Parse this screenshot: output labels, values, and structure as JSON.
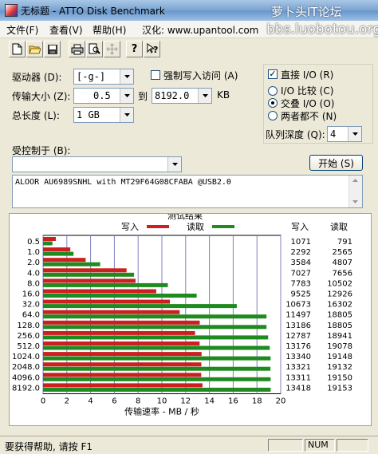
{
  "window": {
    "title": "无标题 - ATTO Disk Benchmark"
  },
  "watermark": {
    "line1": "萝卜头IT论坛",
    "line2": "bbs.luobotou.org"
  },
  "menu": [
    "文件(F)",
    "查看(V)",
    "帮助(H)",
    "汉化: www.upantool.com"
  ],
  "toolbar": {
    "icons": [
      "new-file-icon",
      "open-folder-icon",
      "save-icon",
      "print-icon",
      "print-preview-icon",
      "move-icon",
      "help-icon",
      "context-help-icon"
    ]
  },
  "form": {
    "drive_label": "驱动器 (D):",
    "drive_value": "[-g-]",
    "force_write_label": "强制写入访问 (A)",
    "transfer_label": "传输大小 (Z):",
    "transfer_from": "0.5",
    "to_label": "到",
    "transfer_to": "8192.0",
    "kb_label": "KB",
    "length_label": "总长度 (L):",
    "length_value": "1 GB",
    "direct_io_label": "直接 I/O (R)",
    "direct_io_checked": true,
    "radio_compare": "I/O 比较 (C)",
    "radio_overlap": "交叠 I/O (O)",
    "radio_neither": "两者都不 (N)",
    "selected_radio": "radio_overlap",
    "queue_label": "队列深度 (Q):",
    "queue_value": "4",
    "controlled_label": "受控制于 (B):",
    "controlled_value": "",
    "start_label": "开始 (S)",
    "description": "ALOOR AU6989SNHL with MT29F64G08CFABA @USB2.0"
  },
  "results": {
    "group_label": "测试结果",
    "legend_write": "写入",
    "legend_read": "读取",
    "col_write": "写入",
    "col_read": "读取",
    "xlabel": "传输速率 - MB / 秒"
  },
  "colors": {
    "write": "#cc1f1f",
    "read": "#1f8a1f"
  },
  "chart_data": {
    "type": "bar",
    "orientation": "horizontal",
    "title": "测试结果",
    "xlabel": "传输速率 - MB / 秒",
    "xlim": [
      0,
      20
    ],
    "xticks": [
      0,
      2,
      4,
      6,
      8,
      10,
      12,
      14,
      16,
      18,
      20
    ],
    "grid": true,
    "legend": "top",
    "categories": [
      "0.5",
      "1.0",
      "2.0",
      "4.0",
      "8.0",
      "16.0",
      "32.0",
      "64.0",
      "128.0",
      "256.0",
      "512.0",
      "1024.0",
      "2048.0",
      "4096.0",
      "8192.0"
    ],
    "series": [
      {
        "name": "写入",
        "values": [
          1.071,
          2.292,
          3.584,
          7.027,
          7.783,
          9.525,
          10.673,
          11.497,
          13.186,
          12.787,
          13.176,
          13.34,
          13.321,
          13.311,
          13.418
        ]
      },
      {
        "name": "读取",
        "values": [
          0.791,
          2.565,
          4.807,
          7.656,
          10.502,
          12.926,
          16.302,
          18.805,
          18.805,
          18.941,
          19.078,
          19.148,
          19.132,
          19.15,
          19.153
        ]
      }
    ],
    "table_write": [
      "1071",
      "2292",
      "3584",
      "7027",
      "7783",
      "9525",
      "10673",
      "11497",
      "13186",
      "12787",
      "13176",
      "13340",
      "13321",
      "13311",
      "13418"
    ],
    "table_read": [
      "791",
      "2565",
      "4807",
      "7656",
      "10502",
      "12926",
      "16302",
      "18805",
      "18805",
      "18941",
      "19078",
      "19148",
      "19132",
      "19150",
      "19153"
    ]
  },
  "status": {
    "help": "要获得帮助, 请按 F1",
    "num": "NUM"
  }
}
